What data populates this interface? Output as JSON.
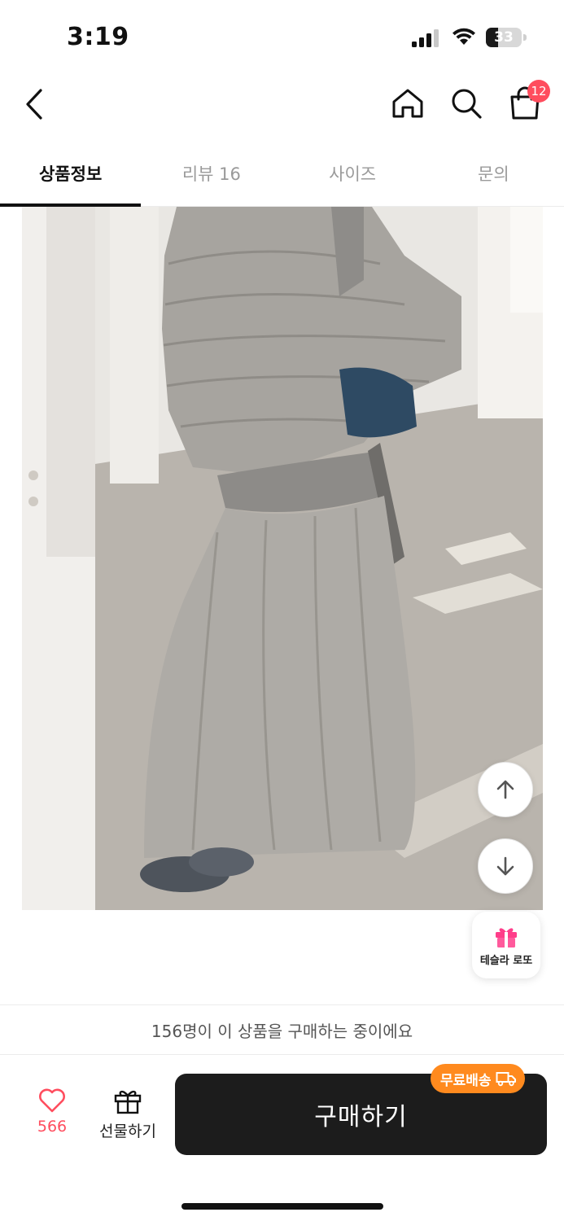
{
  "status_bar": {
    "time": "3:19",
    "battery": "33",
    "battery_level": 0.33
  },
  "nav": {
    "cart_count": "12"
  },
  "tabs": [
    {
      "label": "상품정보",
      "active": true
    },
    {
      "label": "리뷰 16",
      "active": false
    },
    {
      "label": "사이즈",
      "active": false
    },
    {
      "label": "문의",
      "active": false
    }
  ],
  "floating": {
    "lotto_label": "테슬라 로또"
  },
  "purchase_notice": "156명이 이 상품을 구매하는 중이에요",
  "bottom_bar": {
    "like_count": "566",
    "gift_label": "선물하기",
    "buy_label": "구매하기",
    "free_shipping_badge": "무료배송"
  },
  "colors": {
    "accent_red": "#ff4d5e",
    "shipping_orange": "#ff8a1e",
    "buy_button": "#1c1c1c"
  },
  "icons": [
    "back-chevron-icon",
    "home-icon",
    "search-icon",
    "shopping-bag-icon",
    "arrow-up-icon",
    "arrow-down-icon",
    "gift-icon",
    "heart-icon",
    "truck-icon"
  ]
}
